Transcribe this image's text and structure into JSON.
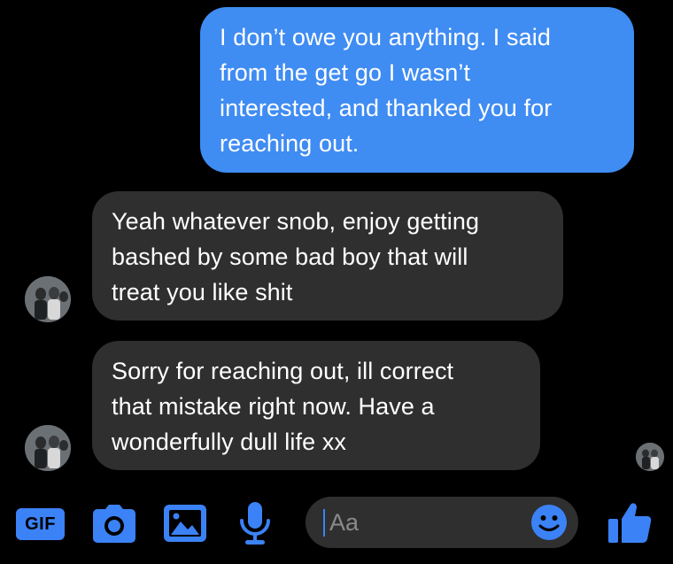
{
  "messages": [
    {
      "direction": "sent",
      "text": "I don’t owe you anything. I said\nfrom the get go I wasn’t\ninterested, and thanked you for\nreaching out."
    },
    {
      "direction": "received",
      "text": "Yeah whatever snob, enjoy getting\nbashed by some bad boy that will\ntreat you like shit"
    },
    {
      "direction": "received",
      "text": "Sorry for reaching out, ill correct\nthat mistake right now. Have a\nwonderfully dull life xx"
    }
  ],
  "composer": {
    "placeholder": "Aa",
    "gif_label": "GIF"
  },
  "icons": {
    "gif": "gif-icon",
    "camera": "camera-icon",
    "photo": "photo-icon",
    "mic": "microphone-icon",
    "emoji": "emoji-icon",
    "like": "thumbs-up-icon"
  },
  "colors": {
    "background": "#000000",
    "sent_bubble": "#3f8cf3",
    "received_bubble": "#2f2f2f",
    "accent": "#3b82f6",
    "placeholder": "#8a8a8a"
  }
}
